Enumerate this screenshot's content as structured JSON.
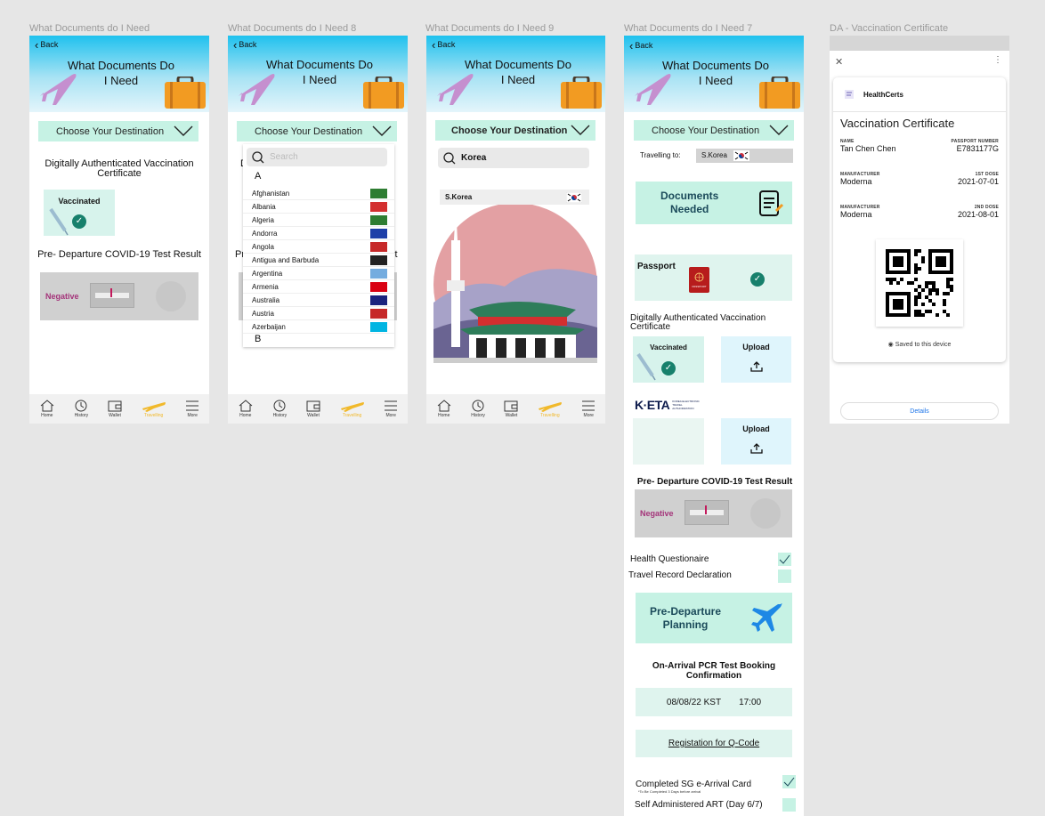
{
  "frames": [
    {
      "label": "What Documents do I Need"
    },
    {
      "label": "What Documents do I Need 8"
    },
    {
      "label": "What Documents do I Need 9"
    },
    {
      "label": "What Documents do I Need 7"
    },
    {
      "label": "DA - Vaccination Certificate"
    }
  ],
  "header": {
    "back": "Back",
    "title_line1": "What Documents Do",
    "title_line2": "I Need"
  },
  "choose": "Choose Your Destination",
  "vaccine_section": "Digitally Authenticated Vaccination Certificate",
  "vaccinated": "Vaccinated",
  "test_section": "Pre- Departure COVID-19 Test Result",
  "negative": "Negative",
  "nav": [
    {
      "label": "Home",
      "icon": "home-icon"
    },
    {
      "label": "History",
      "icon": "history-icon"
    },
    {
      "label": "Wallet",
      "icon": "wallet-icon"
    },
    {
      "label": "Travelling",
      "icon": "plane-icon",
      "active": true
    },
    {
      "label": "More",
      "icon": "menu-icon"
    }
  ],
  "dropdown": {
    "search_placeholder": "Search",
    "letter_a": "A",
    "letter_b": "B",
    "countries": [
      {
        "name": "Afghanistan",
        "flag": "#2e7d32"
      },
      {
        "name": "Albania",
        "flag": "#d32f2f"
      },
      {
        "name": "Algeria",
        "flag": "#2e7d32"
      },
      {
        "name": "Andorra",
        "flag": "#1e3fa8"
      },
      {
        "name": "Angola",
        "flag": "#c62828"
      },
      {
        "name": "Antigua and Barbuda",
        "flag": "#222222"
      },
      {
        "name": "Argentina",
        "flag": "#74acdf"
      },
      {
        "name": "Armenia",
        "flag": "#d90012"
      },
      {
        "name": "Australia",
        "flag": "#1a237e"
      },
      {
        "name": "Austria",
        "flag": "#c62828"
      },
      {
        "name": "Azerbaijan",
        "flag": "#00b5e2"
      }
    ],
    "partial_behind_left": "D",
    "partial_behind_left2": "Pr",
    "partial_behind_right": "lt"
  },
  "frame9": {
    "choose_bold": "Choose Your Destination",
    "search_value": "Korea",
    "result": "S.Korea"
  },
  "frame7": {
    "travelling_to": "Travelling to:",
    "travelling_value": "S.Korea",
    "documents_needed_l1": "Documents",
    "documents_needed_l2": "Needed",
    "passport": "Passport",
    "passport_label": "PASSPORT",
    "vaccine_section": "Digitally Authenticated Vaccination Certificate",
    "upload": "Upload",
    "keta": "K·ETA",
    "keta_sub": "KOREA ELECTRONIC TRAVEL AUTHORIZATION",
    "test_section": "Pre- Departure COVID-19 Test Result",
    "health": "Health Questionaire",
    "travel_record": "Travel Record Declaration",
    "planning_l1": "Pre-Departure",
    "planning_l2": "Planning",
    "pcr_l1": "On-Arrival PCR Test Booking",
    "pcr_l2": "Confirmation",
    "date": "08/08/22 KST",
    "time": "17:00",
    "qcode": "Registation for Q-Code",
    "sg_card": "Completed SG e-Arrival Card",
    "sg_card_note": "*To Be Completed 3 Days before arrival",
    "art": "Self Administered ART (Day 6/7)"
  },
  "cert": {
    "brand": "HealthCerts",
    "title": "Vaccination Certificate",
    "name_k": "NAME",
    "name_v": "Tan Chen Chen",
    "passport_k": "PASSPORT NUMBER",
    "passport_v": "E7831177G",
    "man1_k": "MANUFACTURER",
    "man1_v": "Moderna",
    "dose1_k": "1ST DOSE",
    "dose1_v": "2021-07-01",
    "man2_k": "MANUFACTURER",
    "man2_v": "Moderna",
    "dose2_k": "2ND DOSE",
    "dose2_v": "2021-08-01",
    "saved": "Saved to this device",
    "details": "Details"
  },
  "colors": {
    "mint": "#c6f2e4",
    "teal_check": "#17806c",
    "active_nav": "#f1b92b",
    "plane_pink": "#c58fcf",
    "suitcase": "#f29b22"
  }
}
